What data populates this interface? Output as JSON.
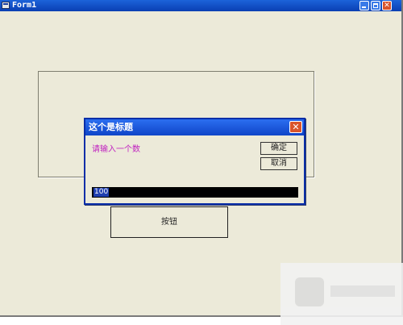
{
  "window": {
    "title": "Form1",
    "controls": {
      "minimize_icon": "minimize-icon",
      "maximize_icon": "maximize-icon",
      "close_icon": "close-icon"
    },
    "button_label": "按钮"
  },
  "dialog": {
    "title": "这个是标题",
    "close_glyph": "✕",
    "prompt": "请输入一个数",
    "ok_label": "确定",
    "cancel_label": "取消",
    "input_value": "100"
  },
  "colors": {
    "titlebar": "#0a3fb3",
    "background": "#ecead9",
    "prompt_text": "#c022c0",
    "close_button": "#d9542b"
  }
}
